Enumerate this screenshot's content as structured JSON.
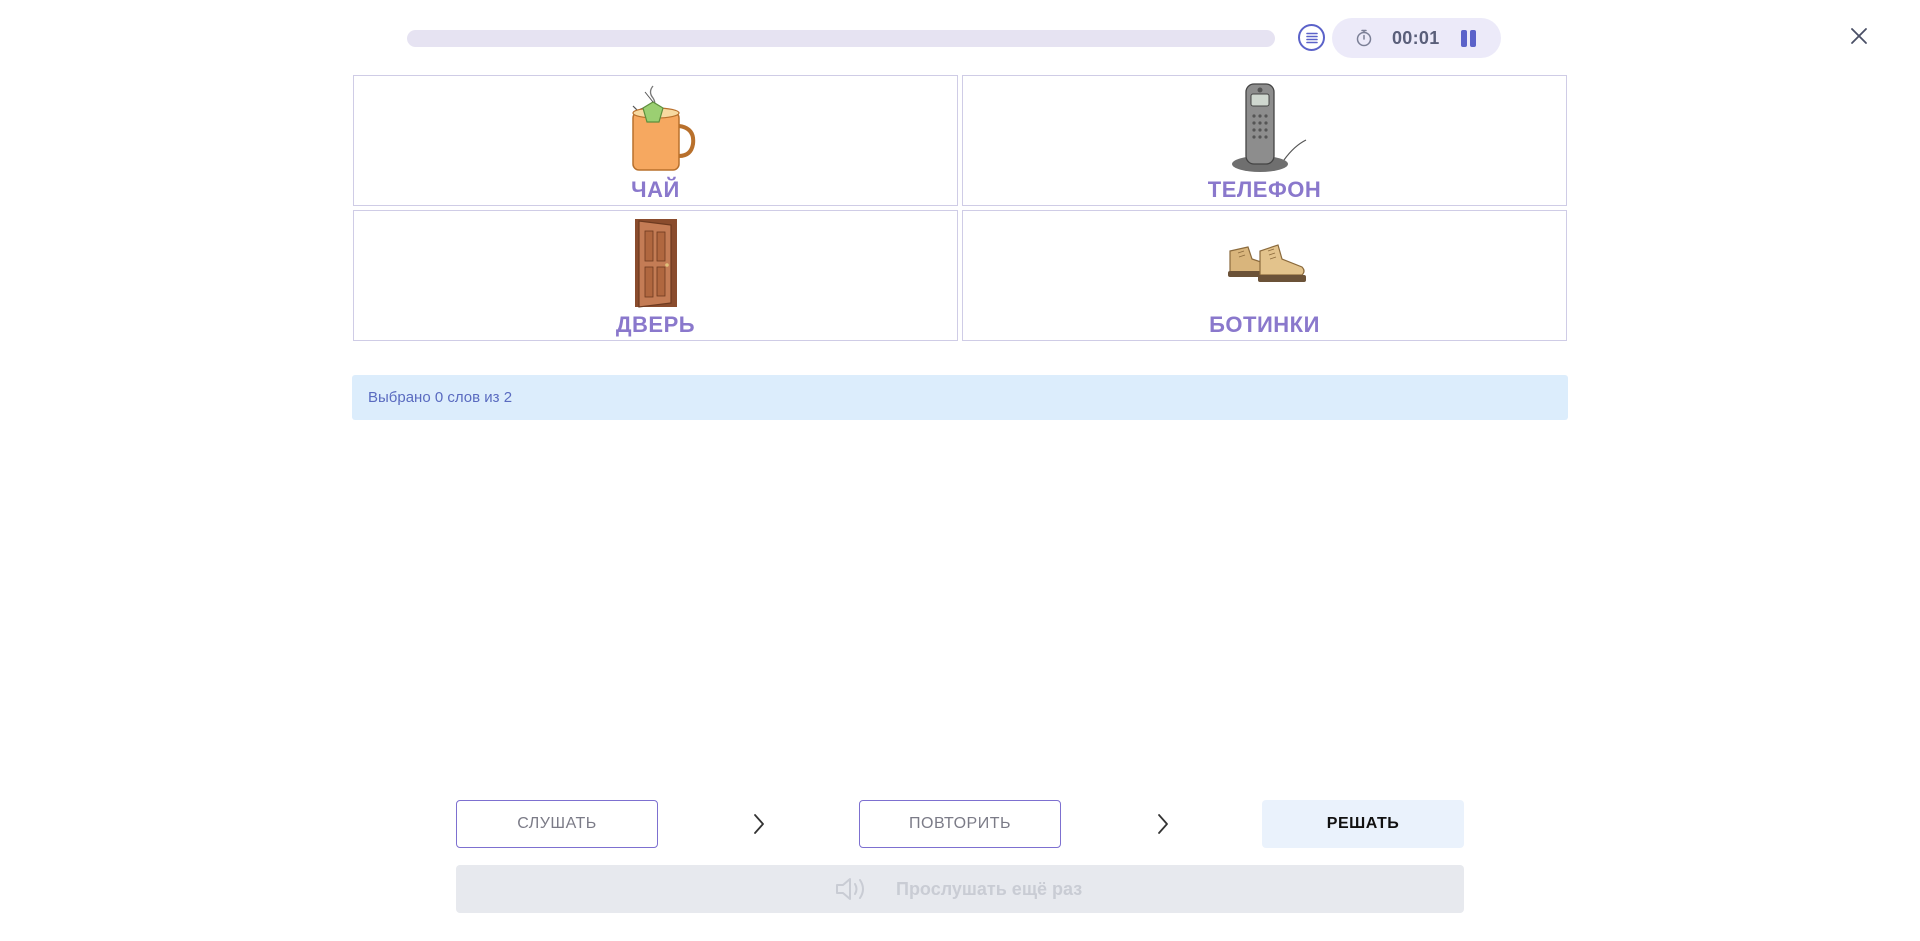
{
  "header": {
    "progress_fraction": 0.0,
    "timer": "00:01",
    "icons": {
      "list": "list-icon",
      "stopwatch": "stopwatch-icon",
      "pause": "pause-icon",
      "close": "close-icon"
    },
    "colors": {
      "accent": "#5b62c9",
      "track": "#e6e3f2",
      "pill": "#eceaf9"
    }
  },
  "cards": [
    {
      "word": "ЧАЙ",
      "icon": "tea-cup-icon"
    },
    {
      "word": "ТЕЛЕФОН",
      "icon": "cordless-phone-icon"
    },
    {
      "word": "ДВЕРЬ",
      "icon": "door-icon"
    },
    {
      "word": "БОТИНКИ",
      "icon": "boots-icon"
    }
  ],
  "status": {
    "text": "Выбрано 0 слов из 2",
    "selected": 0,
    "total": 2
  },
  "steps": {
    "listen": "СЛУШАТЬ",
    "repeat": "ПОВТОРИТЬ",
    "solve": "РЕШАТЬ"
  },
  "replay": {
    "label": "Прослушать ещё раз",
    "icon": "speaker-icon",
    "enabled": false
  },
  "colors": {
    "word": "#8a78cc",
    "card_border": "#cfcce6",
    "status_bg": "#dcedfc",
    "status_text": "#5a6bc0",
    "step_border": "#7d70d0",
    "solve_bg": "#eaf2fc",
    "replay_bg": "#e7e9ee"
  }
}
